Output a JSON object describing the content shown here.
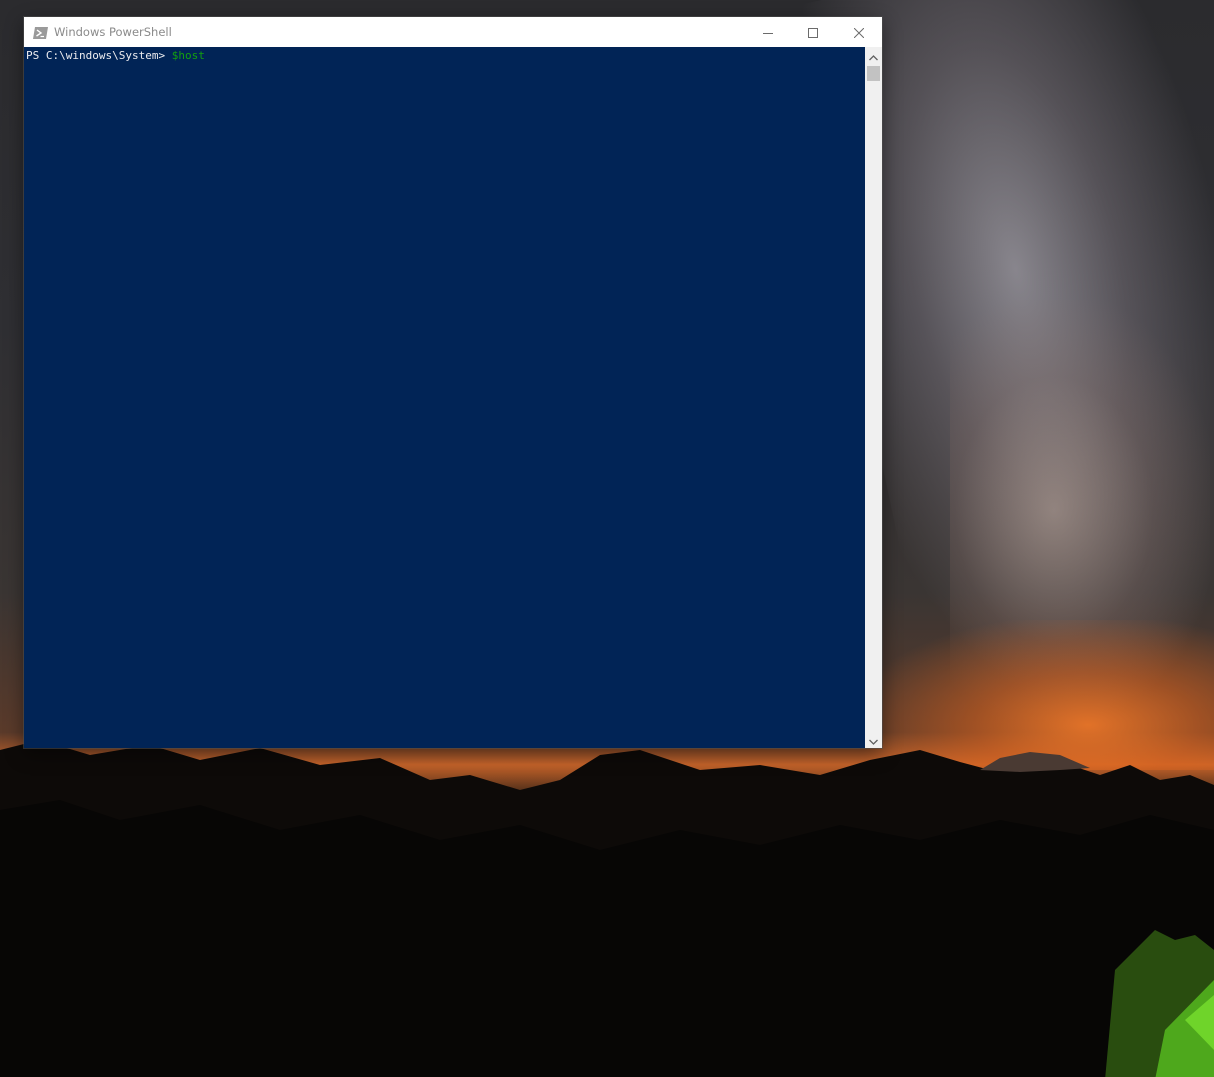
{
  "desktop": {
    "wallpaper": "night-sky-milky-way-mountains-tent"
  },
  "window": {
    "title": "Windows PowerShell",
    "icon": "powershell-icon",
    "controls": {
      "minimize_icon": "minimize-icon",
      "maximize_icon": "maximize-icon",
      "close_icon": "close-icon"
    },
    "console": {
      "background_color": "#012456",
      "prompt": "PS C:\\windows\\System> ",
      "command": "$host",
      "prompt_color": "#eeedf0",
      "command_color": "#13a10e"
    },
    "scrollbar": {
      "up_icon": "chevron-up-icon",
      "down_icon": "chevron-down-icon"
    }
  }
}
